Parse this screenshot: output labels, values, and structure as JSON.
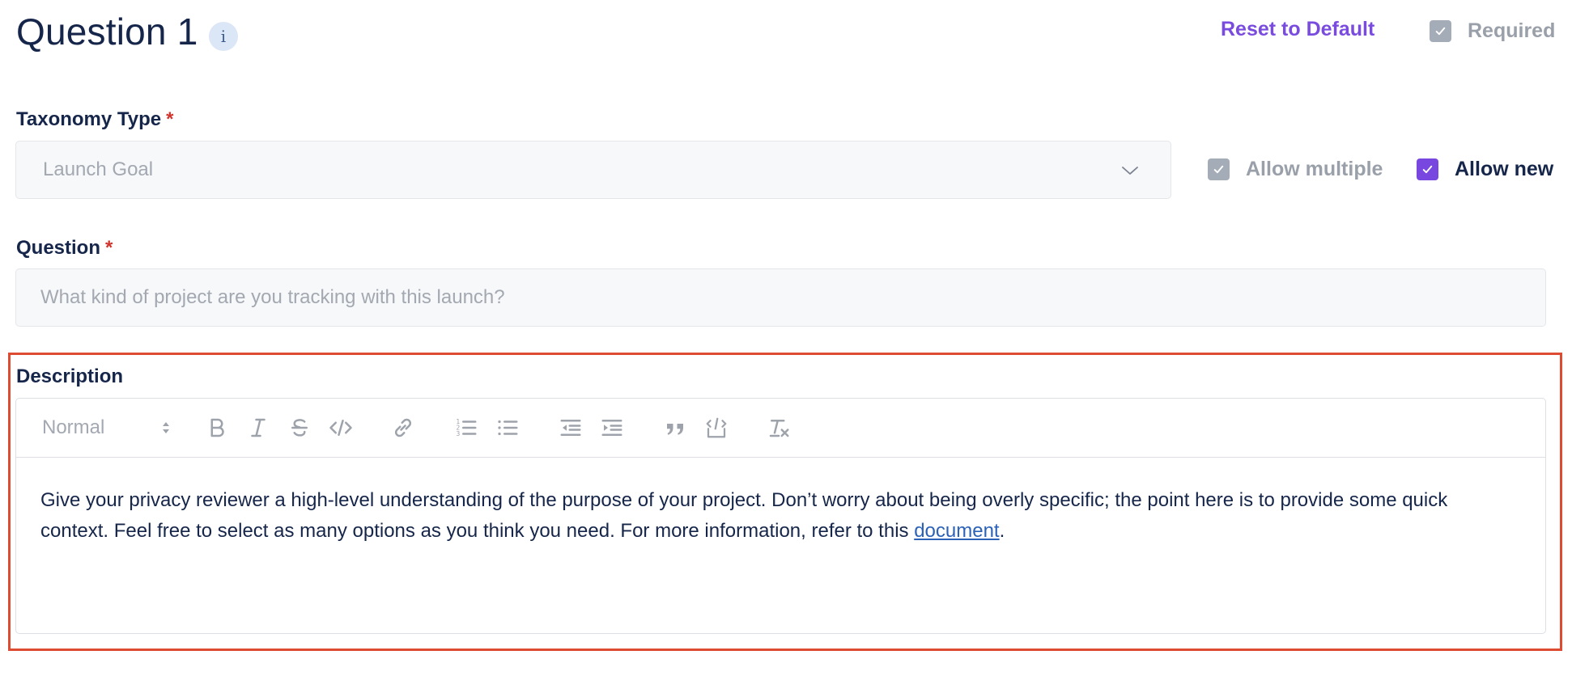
{
  "header": {
    "title": "Question 1",
    "info_glyph": "i",
    "reset_label": "Reset to Default",
    "required_label": "Required",
    "required_checked": true
  },
  "taxonomy": {
    "label": "Taxonomy Type",
    "required_mark": "*",
    "value": "Launch Goal",
    "allow_multiple_label": "Allow multiple",
    "allow_multiple_checked": true,
    "allow_new_label": "Allow new",
    "allow_new_checked": true
  },
  "question": {
    "label": "Question",
    "required_mark": "*",
    "placeholder": "What kind of project are you tracking with this launch?"
  },
  "description": {
    "label": "Description",
    "format_select": "Normal",
    "toolbar_icons": [
      "bold-icon",
      "italic-icon",
      "strikethrough-icon",
      "code-icon",
      "link-icon",
      "ordered-list-icon",
      "bullet-list-icon",
      "outdent-icon",
      "indent-icon",
      "blockquote-icon",
      "code-block-icon",
      "clear-format-icon"
    ],
    "text_before_link": "Give your privacy reviewer a high-level understanding of the purpose of your project. Don’t worry about being overly specific; the point here is to provide some quick context. Feel free to select as many options as you think you need. For more information, refer to this ",
    "link_text": "document",
    "text_after_link": "."
  },
  "colors": {
    "accent": "#7747e0",
    "text_primary": "#16264a",
    "muted": "#a3a8b1",
    "required_star": "#d0342c",
    "link": "#2b62b8",
    "highlight_border": "#dc4b32"
  }
}
